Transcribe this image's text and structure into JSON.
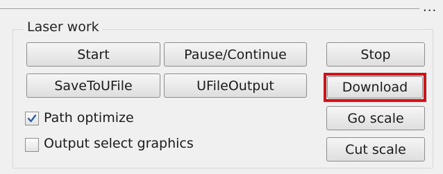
{
  "window": {
    "overflow_glyph": "..."
  },
  "group": {
    "title": "Laser work"
  },
  "buttons": {
    "start": "Start",
    "pause_continue": "Pause/Continue",
    "stop": "Stop",
    "save_to_ufile": "SaveToUFile",
    "ufile_output": "UFileOutput",
    "download": "Download",
    "go_scale": "Go scale",
    "cut_scale": "Cut scale"
  },
  "checkboxes": {
    "path_optimize": {
      "label": "Path optimize",
      "checked": true
    },
    "output_select_graphics": {
      "label": "Output select graphics",
      "checked": false
    }
  },
  "highlight_color": "#c8161d",
  "check_color": "#2a5fa8"
}
